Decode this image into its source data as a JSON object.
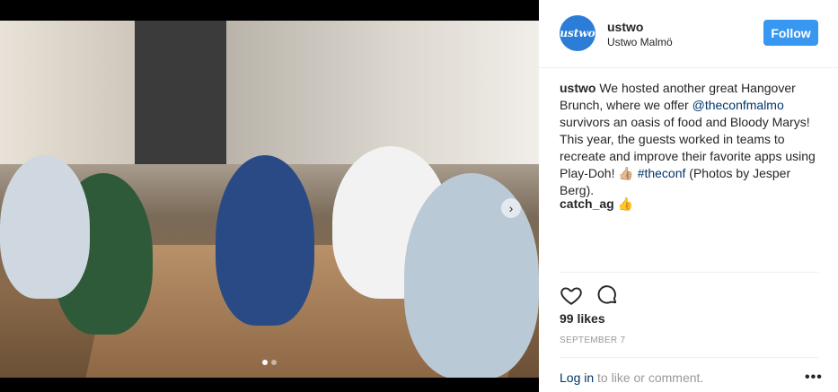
{
  "post": {
    "username": "ustwo",
    "location": "Ustwo Malmö",
    "avatar_text": "ustwo",
    "follow_label": "Follow",
    "caption": {
      "user": "ustwo",
      "text_1": " We hosted another great Hangover Brunch, where we offer ",
      "mention": "@theconfmalmo",
      "text_2": " survivors an oasis of food and Bloody Marys! This year, the guests worked in teams to recreate and improve their favorite apps using Play-Doh! 👍🏼 ",
      "hashtag": "#theconf",
      "text_3": " (Photos by Jesper Berg)."
    },
    "comment": {
      "user": "catch_ag",
      "text": " 👍"
    },
    "likes": "99 likes",
    "date": "SEPTEMBER 7",
    "login_link": "Log in",
    "login_text": " to like or comment.",
    "more": "•••"
  },
  "carousel": {
    "total": 2,
    "active": 1
  },
  "colors": {
    "follow_bg": "#3897f0",
    "link": "#003569",
    "avatar_bg": "#2b7dd8"
  }
}
